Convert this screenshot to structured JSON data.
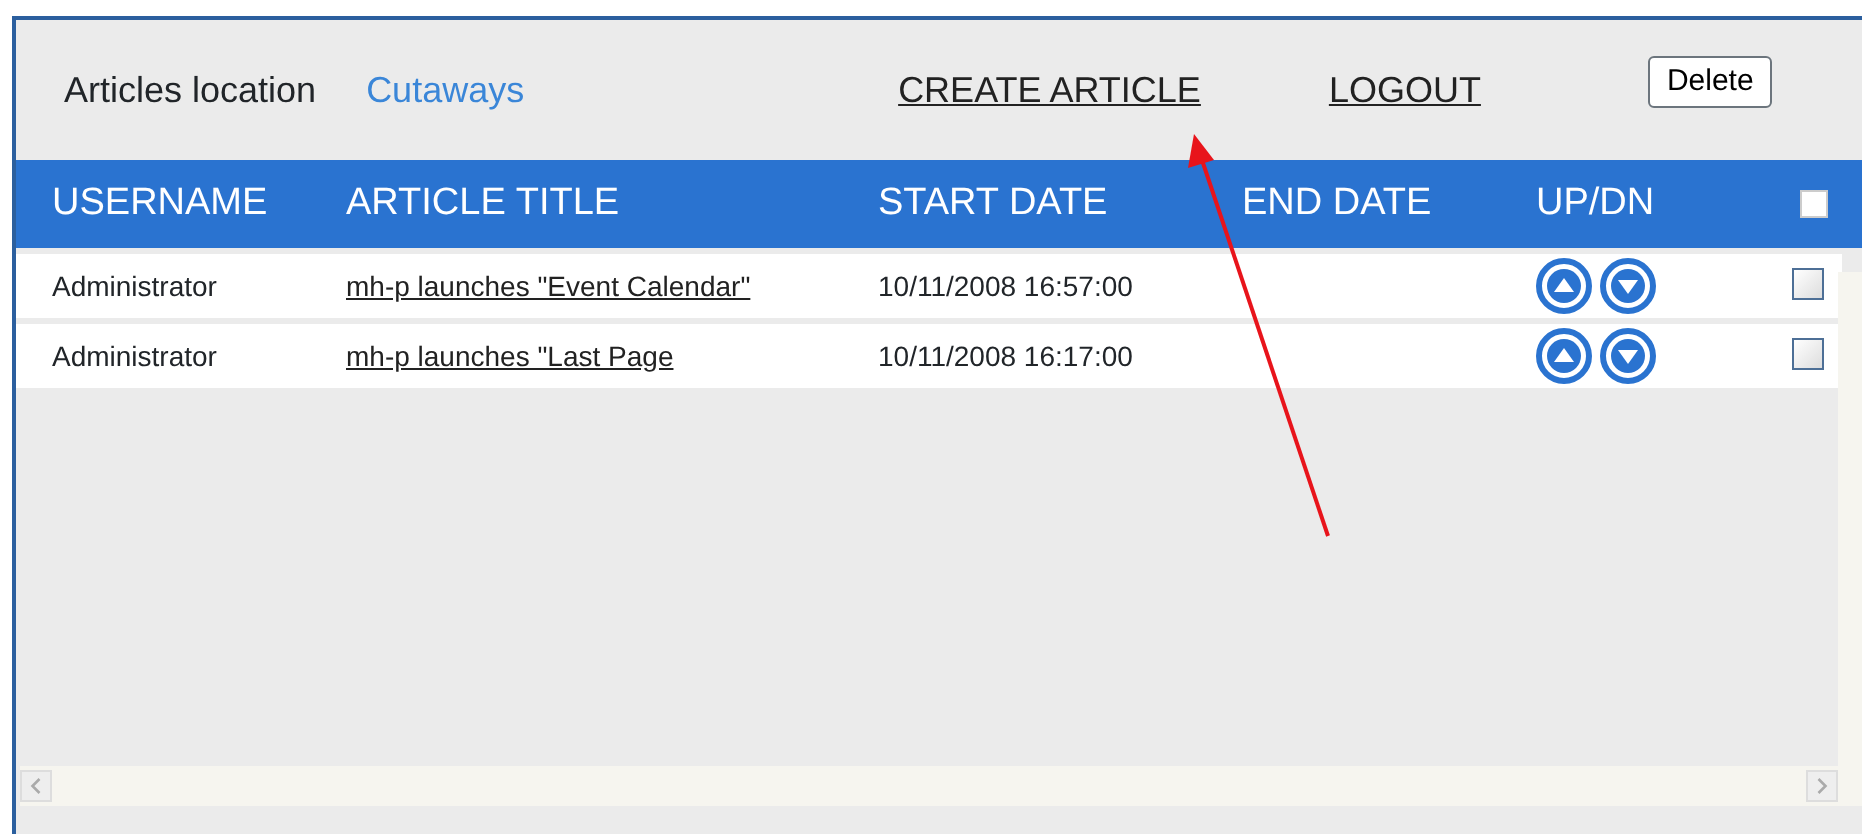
{
  "toolbar": {
    "location_label": "Articles location",
    "location_value": "Cutaways",
    "links": [
      "CREATE ARTICLE",
      "LOGOUT"
    ],
    "delete_button": "Delete"
  },
  "table": {
    "columns": [
      "USERNAME",
      "ARTICLE TITLE",
      "START DATE",
      "END DATE",
      "UP/DN"
    ],
    "select_all_checked": false,
    "rows": [
      {
        "username": "Administrator",
        "title": "mh-p launches \"Event Calendar\"",
        "start_date": "10/11/2008 16:57:00",
        "checked": false
      },
      {
        "username": "Administrator",
        "title": "mh-p launches \"Last Page",
        "start_date": "10/11/2008 16:17:00",
        "checked": false
      }
    ]
  }
}
